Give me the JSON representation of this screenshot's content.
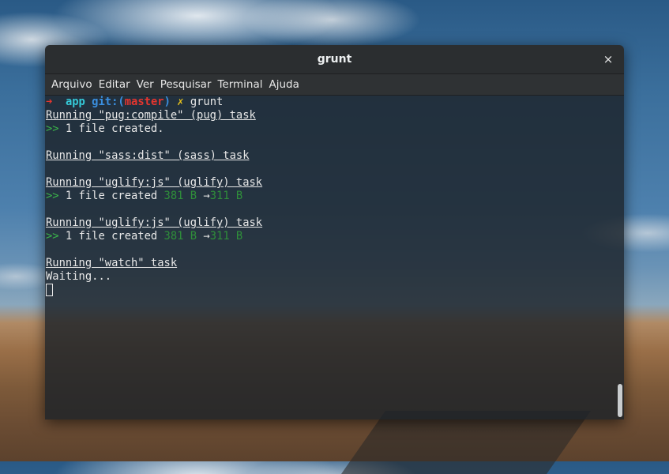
{
  "window": {
    "title": "grunt",
    "close_glyph": "×"
  },
  "menu": [
    "Arquivo",
    "Editar",
    "Ver",
    "Pesquisar",
    "Terminal",
    "Ajuda"
  ],
  "prompt": {
    "arrow": "➜",
    "dir": "app",
    "git_label": "git:(",
    "branch": "master",
    "git_close": ")",
    "dirty_mark": "✗",
    "command": "grunt"
  },
  "output": {
    "task1": "Running \"pug:compile\" (pug) task",
    "task1_marker": ">>",
    "task1_result": " 1 file created.",
    "task2": "Running \"sass:dist\" (sass) task",
    "task3": "Running \"uglify:js\" (uglify) task",
    "task3_marker": ">>",
    "task3_result": " 1 file created ",
    "task3_size_before": "381 B",
    "task3_arrow": " →",
    "task3_size_after": "311 B",
    "task4": "Running \"uglify:js\" (uglify) task",
    "task4_marker": ">>",
    "task4_result": " 1 file created ",
    "task4_size_before": "381 B",
    "task4_arrow": " →",
    "task4_size_after": "311 B",
    "task5": "Running \"watch\" task",
    "waiting": "Waiting..."
  },
  "colors": {
    "prompt_arrow": "#e4352f",
    "dir": "#35c9d8",
    "git": "#3a8fe0",
    "branch": "#e4352f",
    "dirty": "#e8c21c",
    "success": "#3bb54a"
  }
}
